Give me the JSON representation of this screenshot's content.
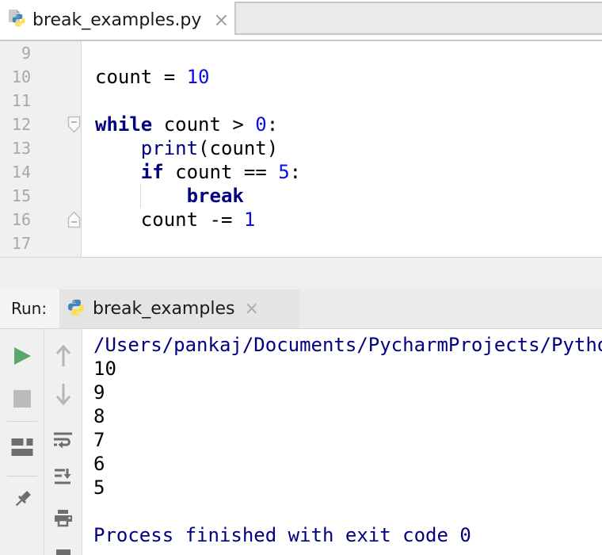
{
  "glyphs": {
    "close": "×"
  },
  "colors": {
    "keyword": "#000080",
    "number": "#0b0ce8",
    "builtin": "#000080",
    "console_system": "#000080",
    "line_number": "#a8a8a8",
    "run_green": "#59A869",
    "stop_gray": "#bbbbbb",
    "icon_dark": "#6e6e6e",
    "icon_light": "#b6b6b6"
  },
  "editor_tab": {
    "title": "break_examples.py"
  },
  "editor": {
    "lines": [
      {
        "num": "9",
        "segs": []
      },
      {
        "num": "10",
        "segs": [
          {
            "t": "count = "
          },
          {
            "t": "10",
            "c": "n"
          }
        ]
      },
      {
        "num": "11",
        "segs": []
      },
      {
        "num": "12",
        "fold": "start",
        "segs": [
          {
            "t": "while",
            "c": "k"
          },
          {
            "t": " count > "
          },
          {
            "t": "0",
            "c": "n"
          },
          {
            "t": ":"
          }
        ]
      },
      {
        "num": "13",
        "segs": [
          {
            "t": "    "
          },
          {
            "t": "print",
            "c": "b"
          },
          {
            "t": "(count)"
          }
        ]
      },
      {
        "num": "14",
        "segs": [
          {
            "t": "    "
          },
          {
            "t": "if",
            "c": "k"
          },
          {
            "t": " count == "
          },
          {
            "t": "5",
            "c": "n"
          },
          {
            "t": ":"
          }
        ]
      },
      {
        "num": "15",
        "guide": true,
        "segs": [
          {
            "t": "        "
          },
          {
            "t": "break",
            "c": "k"
          }
        ]
      },
      {
        "num": "16",
        "fold": "end",
        "segs": [
          {
            "t": "    count -= "
          },
          {
            "t": "1",
            "c": "n"
          }
        ]
      },
      {
        "num": "17",
        "segs": []
      }
    ]
  },
  "run_panel": {
    "label": "Run:",
    "tab": {
      "title": "break_examples"
    }
  },
  "console": {
    "lines": [
      {
        "t": "/Users/pankaj/Documents/PycharmProjects/Pytho",
        "c": "sys"
      },
      {
        "t": "10"
      },
      {
        "t": "9"
      },
      {
        "t": "8"
      },
      {
        "t": "7"
      },
      {
        "t": "6"
      },
      {
        "t": "5"
      },
      {
        "t": ""
      },
      {
        "t": "Process finished with exit code 0",
        "c": "sys"
      }
    ]
  },
  "icons": {
    "editor_tab_icon": "python-file-icon",
    "tab_close_icon": "close-icon",
    "run_tab_icon": "python-icon",
    "run_toolbar": [
      "rerun-icon",
      "stop-icon",
      "restore-layout-icon",
      "pin-icon"
    ],
    "console_toolbar": [
      "up-stack-trace-icon",
      "down-stack-trace-icon",
      "soft-wrap-icon",
      "scroll-to-end-icon",
      "print-icon",
      "clear-all-icon-partial"
    ]
  }
}
